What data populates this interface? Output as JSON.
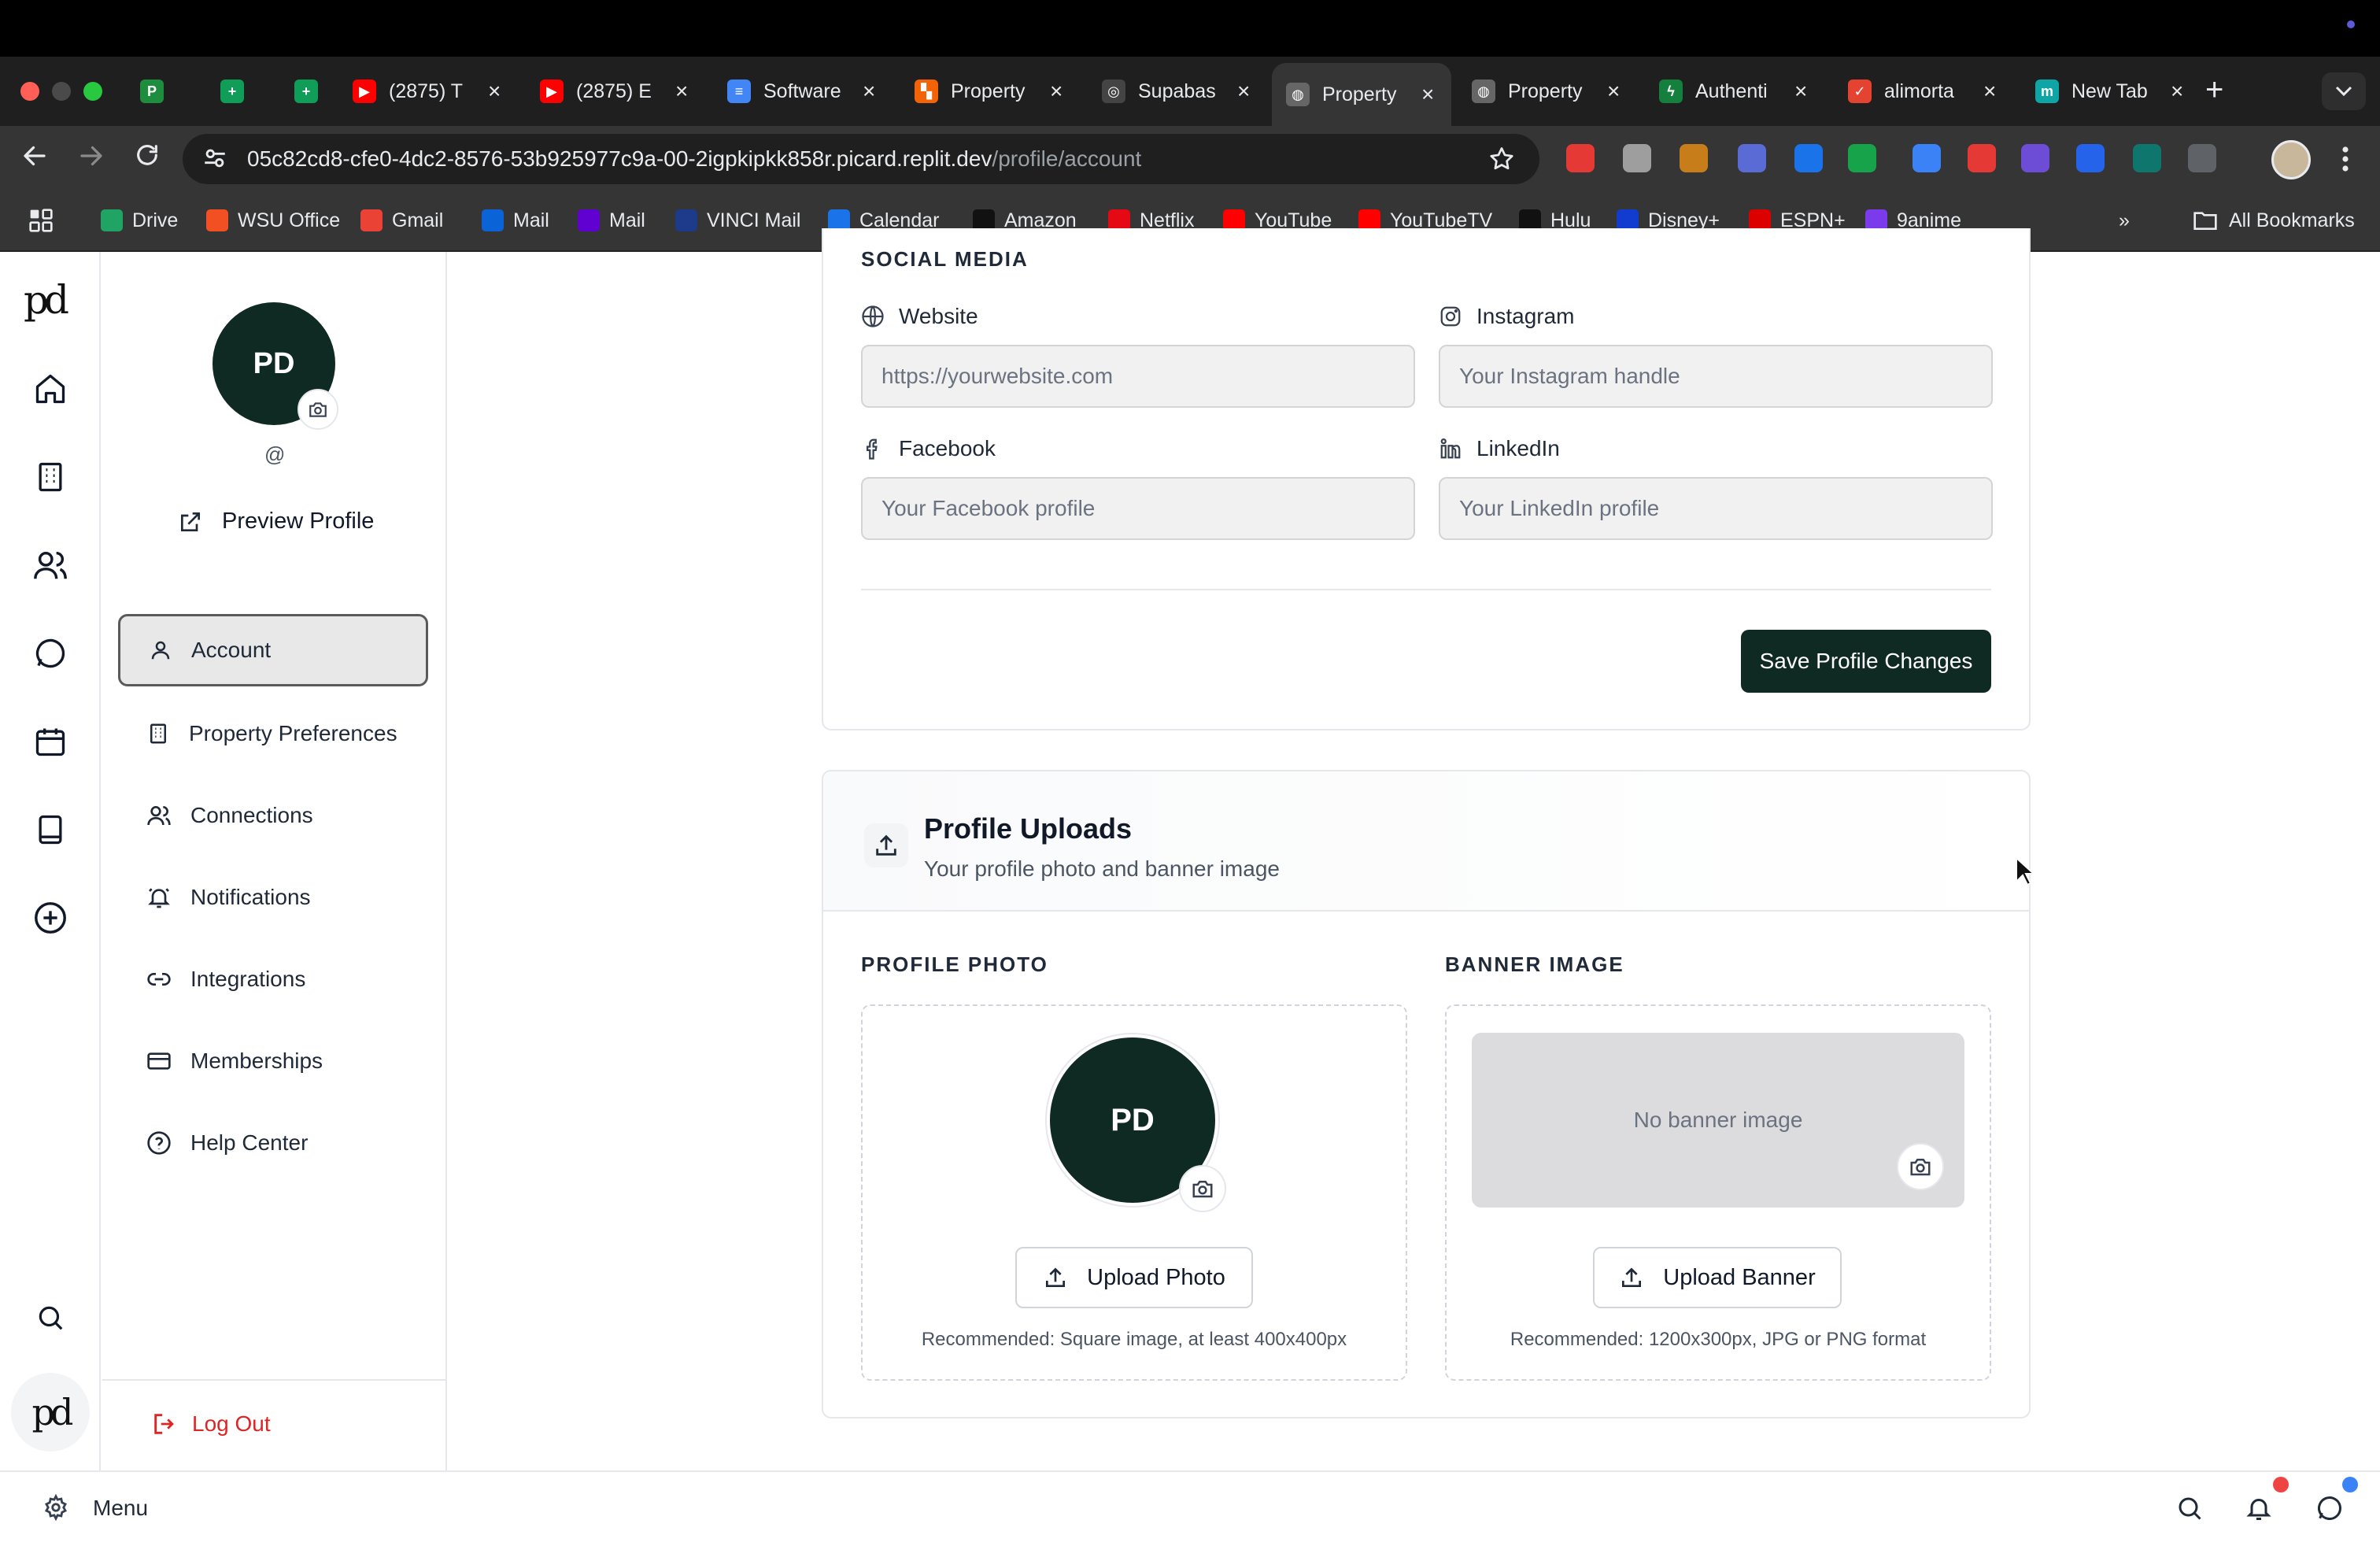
{
  "browser": {
    "tabs": [
      {
        "label": "",
        "favicon": "P",
        "color": "#1e8e3e"
      },
      {
        "label": "",
        "favicon": "+",
        "color": "#0f9d58"
      },
      {
        "label": "",
        "favicon": "+",
        "color": "#0f9d58"
      },
      {
        "label": "(2875) T",
        "favicon": "▶",
        "color": "#ff0000"
      },
      {
        "label": "(2875) E",
        "favicon": "▶",
        "color": "#ff0000"
      },
      {
        "label": "Software",
        "favicon": "≡",
        "color": "#4285f4"
      },
      {
        "label": "Property",
        "favicon": "▚",
        "color": "#f26207"
      },
      {
        "label": "Supabas",
        "favicon": "◎",
        "color": "#444"
      },
      {
        "label": "Property",
        "favicon": "◍",
        "color": "#666",
        "active": true
      },
      {
        "label": "Property",
        "favicon": "◍",
        "color": "#666"
      },
      {
        "label": "Authenti",
        "favicon": "ϟ",
        "color": "#15803d"
      },
      {
        "label": "alimorta",
        "favicon": "✓",
        "color": "#e44332"
      },
      {
        "label": "New Tab",
        "favicon": "m",
        "color": "#0ea5a4"
      }
    ],
    "new_tab_label": "+",
    "url_host": "05c82cd8-cfe0-4dc2-8576-53b925977c9a-00-2igpkipkk858r.picard.replit.dev",
    "url_path": "/profile/account",
    "bookmarks": [
      {
        "label": "Drive",
        "icon": "drive-icon",
        "color": "#1fa463"
      },
      {
        "label": "WSU Office",
        "icon": "office-icon",
        "color": "#f25022"
      },
      {
        "label": "Gmail",
        "icon": "gmail-icon",
        "color": "#ea4335"
      },
      {
        "label": "Mail",
        "icon": "outlook-icon",
        "color": "#0a64d8"
      },
      {
        "label": "Mail",
        "icon": "yahoo-icon",
        "color": "#6001d2"
      },
      {
        "label": "VINCI Mail",
        "icon": "vinci-icon",
        "color": "#1e3a8a"
      },
      {
        "label": "Calendar",
        "icon": "calendar-icon",
        "color": "#1a73e8"
      },
      {
        "label": "Amazon",
        "icon": "amazon-icon",
        "color": "#111"
      },
      {
        "label": "Netflix",
        "icon": "netflix-icon",
        "color": "#e50914"
      },
      {
        "label": "YouTube",
        "icon": "youtube-icon",
        "color": "#ff0000"
      },
      {
        "label": "YouTubeTV",
        "icon": "youtubetv-icon",
        "color": "#ff0000"
      },
      {
        "label": "Hulu",
        "icon": "hulu-icon",
        "color": "#111"
      },
      {
        "label": "Disney+",
        "icon": "disney-icon",
        "color": "#113ccf"
      },
      {
        "label": "ESPN+",
        "icon": "espn-icon",
        "color": "#d00"
      },
      {
        "label": "9anime",
        "icon": "anime-icon",
        "color": "#7c3aed"
      }
    ],
    "overflow_label": "»",
    "all_bookmarks_label": "All Bookmarks"
  },
  "rail": {
    "logo": "pd",
    "items": [
      "home-icon",
      "building-icon",
      "users-icon",
      "chat-icon",
      "calendar-icon",
      "book-icon",
      "plus-circle-icon"
    ],
    "search_icon": "search-icon",
    "bottom_logo": "pd"
  },
  "sidebar": {
    "initials": "PD",
    "handle": "@",
    "preview_label": "Preview Profile",
    "items": [
      {
        "label": "Account",
        "icon": "user-icon",
        "active": true
      },
      {
        "label": "Property Preferences",
        "icon": "building-icon"
      },
      {
        "label": "Connections",
        "icon": "users-icon"
      },
      {
        "label": "Notifications",
        "icon": "bell-icon"
      },
      {
        "label": "Integrations",
        "icon": "link-icon"
      },
      {
        "label": "Memberships",
        "icon": "credit-card-icon"
      },
      {
        "label": "Help Center",
        "icon": "help-circle-icon"
      }
    ],
    "logout_label": "Log Out"
  },
  "social": {
    "heading": "SOCIAL MEDIA",
    "website_label": "Website",
    "website_placeholder": "https://yourwebsite.com",
    "instagram_label": "Instagram",
    "instagram_placeholder": "Your Instagram handle",
    "facebook_label": "Facebook",
    "facebook_placeholder": "Your Facebook profile",
    "linkedin_label": "LinkedIn",
    "linkedin_placeholder": "Your LinkedIn profile",
    "save_label": "Save Profile Changes"
  },
  "uploads": {
    "title": "Profile Uploads",
    "subtitle": "Your profile photo and banner image",
    "photo_heading": "PROFILE PHOTO",
    "photo_initials": "PD",
    "upload_photo_label": "Upload Photo",
    "photo_hint": "Recommended: Square image, at least 400x400px",
    "banner_heading": "BANNER IMAGE",
    "banner_placeholder": "No banner image",
    "upload_banner_label": "Upload Banner",
    "banner_hint": "Recommended: 1200x300px, JPG or PNG format"
  },
  "bottom": {
    "menu_label": "Menu"
  },
  "colors": {
    "brand_dark": "#0f2a23",
    "danger": "#dc2626",
    "notif_red": "#ef4444",
    "notif_blue": "#3b82f6"
  }
}
